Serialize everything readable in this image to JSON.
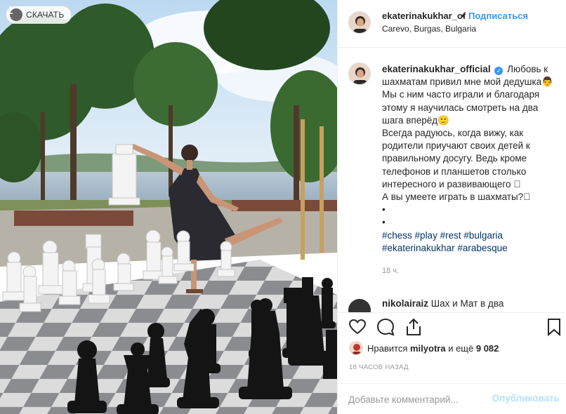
{
  "download": {
    "label": "СКАЧАТЬ"
  },
  "header": {
    "username": "ekaterinakukhar_of",
    "separator": "•",
    "follow_label": "Подписаться",
    "location": "Carevo, Burgas, Bulgaria"
  },
  "caption": {
    "username": "ekaterinakukhar_official",
    "verified_glyph": "✓",
    "lines": [
      "Любовь к шахматам привил мне мой дедушка👨",
      "Мы с ним часто играли и благодаря этому я научилась смотреть на два шага вперёд🙂",
      "Всегда радуюсь, когда вижу, как родители приучают своих детей к правильному досугу. Ведь кроме телефонов и планшетов столько интересного и развивающего 🏻",
      "А вы умеете играть в шахматы?🏻",
      "•",
      "•"
    ],
    "hashtags_line1": [
      "#chess",
      "#play",
      "#rest",
      "#bulgaria"
    ],
    "hashtags_line2": [
      "#ekaterinakukhar",
      "#arabesque"
    ],
    "time": "18 ч."
  },
  "comment2": {
    "username": "nikolairaiz",
    "text": "Шах и Мат в два"
  },
  "actions": {
    "icons": [
      "heart-icon",
      "comment-icon",
      "share-icon",
      "bookmark-icon"
    ]
  },
  "likes": {
    "prefix": "Нравится",
    "user": "milyotra",
    "and_more": "и ещё",
    "count": "9 082"
  },
  "timeago": "18 ЧАСОВ НАЗАД",
  "add_comment": {
    "placeholder": "Добавьте комментарий...",
    "publish_label": "Опубликовать"
  }
}
